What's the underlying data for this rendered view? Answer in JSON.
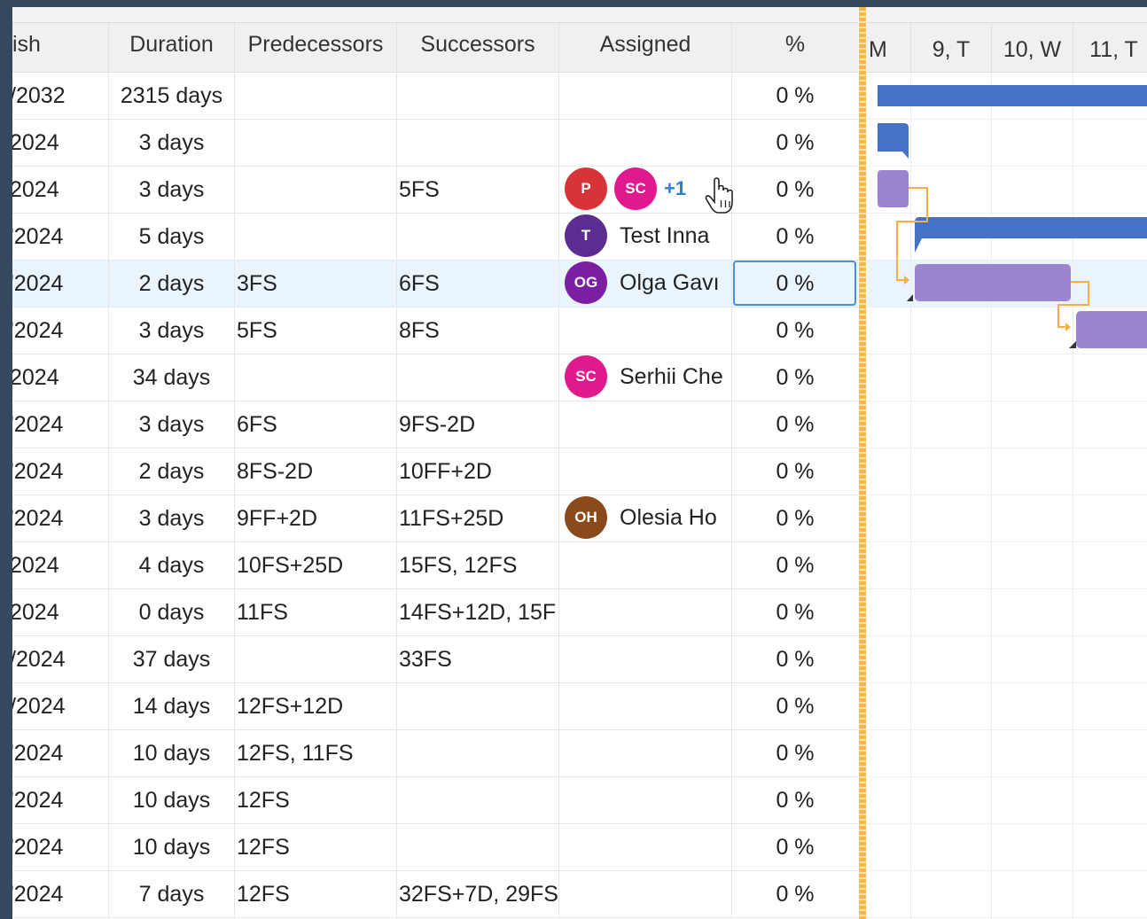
{
  "columns": {
    "finish": "ish",
    "duration": "Duration",
    "predecessors": "Predecessors",
    "successors": "Successors",
    "assigned": "Assigned",
    "percent": "%"
  },
  "gantt_days": [
    "M",
    "9, T",
    "10, W",
    "11, T"
  ],
  "rows": [
    {
      "finish": "/2032",
      "duration": "2315 days",
      "pred": "",
      "succ": "",
      "assigned": "",
      "pct": "0 %"
    },
    {
      "finish": "2024",
      "duration": "3 days",
      "pred": "",
      "succ": "",
      "assigned": "",
      "pct": "0 %"
    },
    {
      "finish": "2024",
      "duration": "3 days",
      "pred": "",
      "succ": "5FS",
      "assigned": "",
      "pct": "0 %",
      "avatars": [
        {
          "initials": "P",
          "color": "#d63438"
        },
        {
          "initials": "SC",
          "color": "#e0198c"
        }
      ],
      "more": "+1"
    },
    {
      "finish": "'2024",
      "duration": "5 days",
      "pred": "",
      "succ": "",
      "assigned": "Test Inna",
      "pct": "0 %",
      "avatar": {
        "initials": "T",
        "color": "#5c2d91"
      }
    },
    {
      "finish": "'2024",
      "duration": "2 days",
      "pred": "3FS",
      "succ": "6FS",
      "assigned": "Olga Gavı",
      "pct": "0 %",
      "avatar": {
        "initials": "OG",
        "color": "#7b1fa2"
      },
      "selected": true
    },
    {
      "finish": "'2024",
      "duration": "3 days",
      "pred": "5FS",
      "succ": "8FS",
      "assigned": "",
      "pct": "0 %"
    },
    {
      "finish": "2024",
      "duration": "34 days",
      "pred": "",
      "succ": "",
      "assigned": "Serhii Che",
      "pct": "0 %",
      "avatar": {
        "initials": "SC",
        "color": "#e0198c"
      }
    },
    {
      "finish": "'2024",
      "duration": "3 days",
      "pred": "6FS",
      "succ": "9FS-2D",
      "assigned": "",
      "pct": "0 %"
    },
    {
      "finish": "'2024",
      "duration": "2 days",
      "pred": "8FS-2D",
      "succ": "10FF+2D",
      "assigned": "",
      "pct": "0 %"
    },
    {
      "finish": "'2024",
      "duration": "3 days",
      "pred": "9FF+2D",
      "succ": "11FS+25D",
      "assigned": "Olesia Ho",
      "pct": "0 %",
      "avatar": {
        "initials": "OH",
        "color": "#8b4a1c"
      }
    },
    {
      "finish": "2024",
      "duration": "4 days",
      "pred": "10FS+25D",
      "succ": "15FS, 12FS",
      "assigned": "",
      "pct": "0 %"
    },
    {
      "finish": "2024",
      "duration": "0 days",
      "pred": "11FS",
      "succ": "14FS+12D, 15F",
      "assigned": "",
      "pct": "0 %"
    },
    {
      "finish": "/2024",
      "duration": "37 days",
      "pred": "",
      "succ": "33FS",
      "assigned": "",
      "pct": "0 %"
    },
    {
      "finish": "/2024",
      "duration": "14 days",
      "pred": "12FS+12D",
      "succ": "",
      "assigned": "",
      "pct": "0 %"
    },
    {
      "finish": "'2024",
      "duration": "10 days",
      "pred": "12FS, 11FS",
      "succ": "",
      "assigned": "",
      "pct": "0 %"
    },
    {
      "finish": "'2024",
      "duration": "10 days",
      "pred": "12FS",
      "succ": "",
      "assigned": "",
      "pct": "0 %"
    },
    {
      "finish": "'2024",
      "duration": "10 days",
      "pred": "12FS",
      "succ": "",
      "assigned": "",
      "pct": "0 %"
    },
    {
      "finish": "'2024",
      "duration": "7 days",
      "pred": "12FS",
      "succ": "32FS+7D, 29FS",
      "assigned": "",
      "pct": "0 %"
    }
  ],
  "colors": {
    "summary_bar": "#4472c4",
    "task_bar": "#9b84d0",
    "link": "#f5b041",
    "selection": "#eaf4fc",
    "focus": "#4a90d9"
  }
}
